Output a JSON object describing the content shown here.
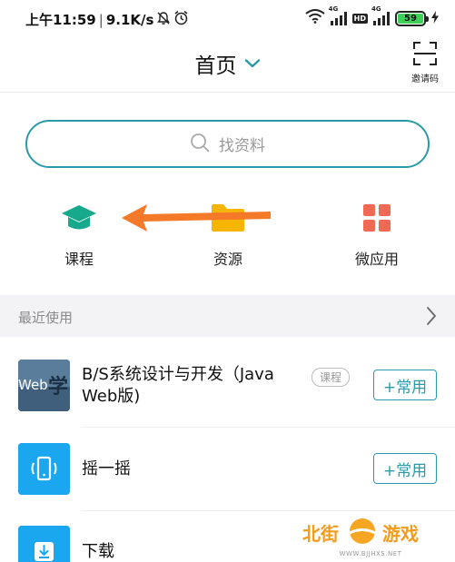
{
  "status_bar": {
    "time": "上午11:59",
    "speed": "9.1K/s",
    "network_label_1": "4G",
    "network_label_2": "4G",
    "hd": "HD",
    "battery": "59",
    "icons": [
      "mute-icon",
      "alarm-icon",
      "wifi-icon",
      "signal-icon",
      "charging-icon"
    ]
  },
  "header": {
    "title": "首页",
    "invite_label": "邀请码",
    "accent": "#2a9aa8"
  },
  "search": {
    "placeholder": "找资料"
  },
  "nav": {
    "course": {
      "label": "课程",
      "icon": "graduation-cap-icon",
      "color": "#16a98c"
    },
    "resource": {
      "label": "资源",
      "icon": "folder-icon",
      "color": "#f7b500"
    },
    "micro_app": {
      "label": "微应用",
      "icon": "apps-grid-icon",
      "color": "#ee6a55"
    }
  },
  "recent": {
    "title": "最近使用",
    "items": [
      {
        "title_line1": "B/S系统设计与开发（Java",
        "title_line2": "Web版)",
        "badge": "课程",
        "thumb_text": "Web",
        "thumb_glyph": "学",
        "action": "+常用"
      },
      {
        "title": "摇一摇",
        "icon": "phone-shake-icon",
        "thumb_color": "#1aa7f0",
        "action": "+常用"
      },
      {
        "title": "下载",
        "icon": "download-icon",
        "thumb_color": "#1aa7f0"
      }
    ]
  },
  "watermark": {
    "text_left": "北街",
    "text_right": "游戏",
    "url": "WWW.BJJHXS.NET"
  }
}
